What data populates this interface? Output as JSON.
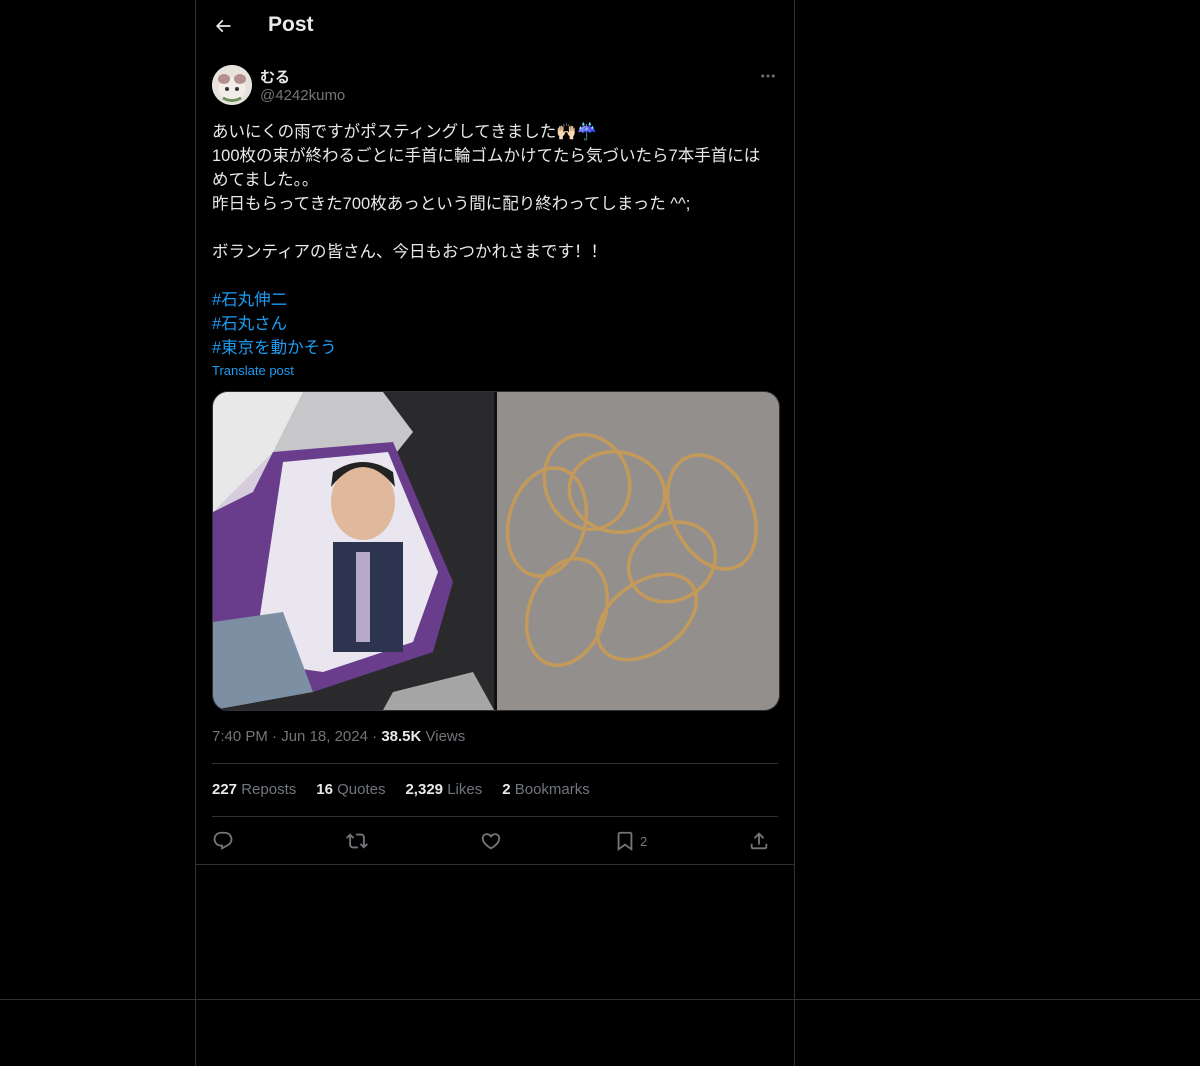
{
  "header": {
    "title": "Post"
  },
  "author": {
    "display_name": "むる",
    "handle": "@4242kumo"
  },
  "post": {
    "lines": [
      "あいにくの雨ですがポスティングしてきました🙌🏻☔️",
      "100枚の束が終わるごとに手首に輪ゴムかけてたら気づいたら7本手首には",
      "めてました。。",
      "昨日もらってきた700枚あっという間に配り終わってしまった ^^;",
      "",
      "ボランティアの皆さん、今日もおつかれさまです！！",
      ""
    ],
    "hashtags": [
      "#石丸伸二",
      "#石丸さん",
      "#東京を動かそう"
    ],
    "translate_label": "Translate post"
  },
  "meta": {
    "time": "7:40 PM",
    "date": "Jun 18, 2024",
    "views_count": "38.5K",
    "views_label": "Views",
    "separator": "·"
  },
  "stats": {
    "reposts": {
      "count": "227",
      "label": "Reposts"
    },
    "quotes": {
      "count": "16",
      "label": "Quotes"
    },
    "likes": {
      "count": "2,329",
      "label": "Likes"
    },
    "bookmarks": {
      "count": "2",
      "label": "Bookmarks"
    }
  },
  "actions": {
    "bookmark_count": "2"
  },
  "colors": {
    "accent": "#1d9bf0",
    "muted": "#71767b",
    "border": "#2f3336",
    "text": "#e7e9ea"
  }
}
